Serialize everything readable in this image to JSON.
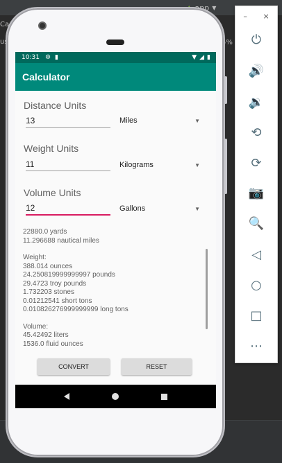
{
  "ide": {
    "run_config": "app",
    "left_snippet_1": "Ca",
    "left_snippet_2": "us",
    "right_snippet": "5%"
  },
  "status_bar": {
    "time": "10:31",
    "left_icons": [
      "gear-icon",
      "sd-card-icon"
    ],
    "right_icons": [
      "wifi-icon",
      "signal-icon",
      "battery-icon"
    ]
  },
  "app_bar": {
    "title": "Calculator"
  },
  "distance": {
    "label": "Distance Units",
    "value": "13",
    "unit": "Miles"
  },
  "weight": {
    "label": "Weight Units",
    "value": "11",
    "unit": "Kilograms"
  },
  "volume": {
    "label": "Volume Units",
    "value": "12",
    "unit": "Gallons"
  },
  "results": {
    "distance_lines": [
      "22880.0 yards",
      "11.296688 nautical miles"
    ],
    "weight_header": "Weight:",
    "weight_lines": [
      "388.014 ounces",
      "24.250819999999997 pounds",
      "29.4723 troy pounds",
      "1.732203 stones",
      "0.01212541 short tons",
      "0.010826276999999999 long tons"
    ],
    "volume_header": "Volume:",
    "volume_lines": [
      "45.42492 liters",
      "1536.0 fluid ounces"
    ]
  },
  "buttons": {
    "convert": "CONVERT",
    "reset": "RESET"
  },
  "emulator_toolbar": {
    "minimize": "–",
    "close": "×",
    "buttons": [
      "power-icon",
      "volume-up-icon",
      "volume-down-icon",
      "rotate-left-icon",
      "rotate-right-icon",
      "camera-icon",
      "zoom-icon",
      "back-icon",
      "home-icon",
      "overview-icon",
      "more-icon"
    ]
  }
}
